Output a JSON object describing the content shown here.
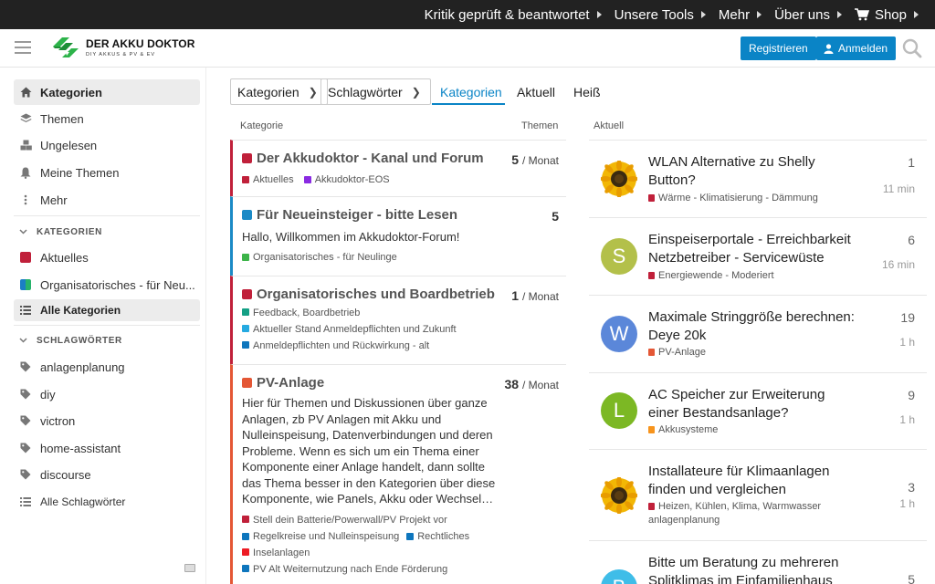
{
  "topbar": {
    "items": [
      {
        "label": "Kritik geprüft & beantwortet"
      },
      {
        "label": "Unsere Tools"
      },
      {
        "label": "Mehr"
      },
      {
        "label": "Über uns"
      },
      {
        "label": "Shop"
      }
    ]
  },
  "header": {
    "logo_title": "DER AKKU DOKTOR",
    "logo_subtitle": "DIY AKKUS & PV & EV",
    "register": "Registrieren",
    "login": "Anmelden"
  },
  "sidebar": {
    "main": [
      {
        "label": "Kategorien",
        "icon": "home-icon"
      },
      {
        "label": "Themen",
        "icon": "layers-icon"
      },
      {
        "label": "Ungelesen",
        "icon": "cubes-icon"
      },
      {
        "label": "Meine Themen",
        "icon": "bell-icon"
      },
      {
        "label": "Mehr",
        "icon": "more-vertical-icon"
      }
    ],
    "categories_header": "KATEGORIEN",
    "categories": [
      {
        "label": "Aktuelles",
        "color": "#c0203a"
      },
      {
        "label": "Organisatorisches - für Neu...",
        "color": "#1b7fc4",
        "color2": "#27b36b"
      },
      {
        "label": "Alle Kategorien",
        "icon": "list-icon"
      }
    ],
    "tags_header": "SCHLAGWÖRTER",
    "tags": [
      {
        "label": "anlagenplanung"
      },
      {
        "label": "diy"
      },
      {
        "label": "victron"
      },
      {
        "label": "home-assistant"
      },
      {
        "label": "discourse"
      },
      {
        "label": "Alle Schlagwörter",
        "icon": "list-icon"
      }
    ]
  },
  "navigation": {
    "breadcrumb_categories": "Kategorien",
    "breadcrumb_tags": "Schlagwörter",
    "tabs": [
      {
        "label": "Kategorien"
      },
      {
        "label": "Aktuell"
      },
      {
        "label": "Heiß"
      }
    ]
  },
  "categories_table": {
    "col_category": "Kategorie",
    "col_topics": "Themen",
    "rows": [
      {
        "name": "Der Akkudoktor - Kanal und Forum",
        "color": "#c0203a",
        "count": "5",
        "period": "/ Monat",
        "description": "",
        "subcategories": [
          {
            "name": "Aktuelles",
            "color": "#c0203a"
          },
          {
            "name": "Akkudoktor-EOS",
            "color": "#8a2be2"
          }
        ]
      },
      {
        "name": "Für Neueinsteiger - bitte Lesen",
        "color": "#1b8ac6",
        "count": "5",
        "period": "",
        "description": "Hallo, Willkommen im Akkudoktor-Forum!",
        "subcategories": [
          {
            "name": "Organisatorisches - für Neulinge",
            "color": "#3cb449"
          }
        ]
      },
      {
        "name": "Organisatorisches und Boardbetrieb",
        "color": "#c0203a",
        "count": "1",
        "period": "/ Monat",
        "description": "",
        "subcategories": [
          {
            "name": "Feedback, Boardbetrieb",
            "color": "#14a085"
          },
          {
            "name": "Aktueller Stand Anmeldepflichten und Zukunft",
            "color": "#25aae1"
          },
          {
            "name": "Anmeldepflichten und Rückwirkung - alt",
            "color": "#0e76bd"
          }
        ]
      },
      {
        "name": "PV-Anlage",
        "color": "#e45735",
        "count": "38",
        "period": "/ Monat",
        "description": "Hier für Themen und Diskussionen über ganze Anlagen, zb PV Anlagen mit Akku und Nulleinspeisung, Datenverbindungen und deren Probleme. Wenn es sich um ein Thema einer Komponente einer Anlage handelt, dann sollte das Thema besser in den Kategorien über diese Komponente, wie Panels, Akku oder Wechsel…",
        "subcategories": [
          {
            "name": "Stell dein Batterie/Powerwall/PV Projekt vor",
            "color": "#c0203a"
          },
          {
            "name": "Regelkreise und Nulleinspeisung",
            "color": "#0e76bd"
          },
          {
            "name": "Rechtliches",
            "color": "#0e76bd"
          },
          {
            "name": "Inselanlagen",
            "color": "#ed1c24"
          },
          {
            "name": "PV Alt Weiternutzung nach Ende Förderung",
            "color": "#0e76bd"
          }
        ]
      }
    ]
  },
  "latest": {
    "header": "Aktuell",
    "topics": [
      {
        "title": "WLAN Alternative zu Shelly Button?",
        "category": "Wärme - Klimatisierung - Dämmung",
        "cat_color": "#c0203a",
        "tags": "",
        "posts": "1",
        "time": "11 min",
        "avatar": "sunflower",
        "avatar_letter": "",
        "avatar_color": ""
      },
      {
        "title": "Einspeiserportale - Erreichbarkeit Netzbetreiber - Servicewüste",
        "category": "Energiewende - Moderiert",
        "cat_color": "#c0203a",
        "tags": "",
        "posts": "6",
        "time": "16 min",
        "avatar": "letter",
        "avatar_letter": "S",
        "avatar_color": "#b3c04a"
      },
      {
        "title": "Maximale Stringgröße berechnen: Deye 20k",
        "category": "PV-Anlage",
        "cat_color": "#e45735",
        "tags": "",
        "posts": "19",
        "time": "1 h",
        "avatar": "letter",
        "avatar_letter": "W",
        "avatar_color": "#5b87d9"
      },
      {
        "title": "AC Speicher zur Erweiterung einer Bestandsanlage?",
        "category": "Akkusysteme",
        "cat_color": "#f7941d",
        "tags": "",
        "posts": "9",
        "time": "1 h",
        "avatar": "letter",
        "avatar_letter": "L",
        "avatar_color": "#7cb824"
      },
      {
        "title": "Installateure für Klimaanlagen finden und vergleichen",
        "category": "Heizen, Kühlen, Klima, Warmwasser",
        "cat_color": "#c0203a",
        "tags": "anlagenplanung",
        "posts": "3",
        "time": "1 h",
        "avatar": "sunflower",
        "avatar_letter": "",
        "avatar_color": ""
      },
      {
        "title": "Bitte um Beratung zu mehreren Splitklimas im Einfamilienhaus",
        "category": "",
        "cat_color": "#25aae1",
        "tags": "",
        "posts": "5",
        "time": "",
        "avatar": "letter",
        "avatar_letter": "B",
        "avatar_color": "#3fbde8"
      }
    ]
  }
}
